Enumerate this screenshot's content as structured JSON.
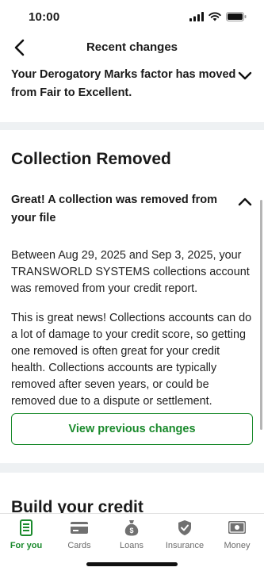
{
  "status_bar": {
    "time": "10:00"
  },
  "nav": {
    "title": "Recent changes"
  },
  "factor_card": {
    "text": "Your Derogatory Marks factor has moved from Fair to Excellent."
  },
  "collection_card": {
    "title": "Collection Removed",
    "accordion_title": "Great! A collection was removed from your file",
    "paragraph_1": "Between Aug 29, 2025 and Sep 3, 2025, your TRANSWORLD SYSTEMS collections account was removed from your credit report.",
    "paragraph_2": "This is great news! Collections accounts can do a lot of damage to your credit score, so getting one removed is often great for your credit health. Collections accounts are typically removed after seven years, or could be removed due to a dispute or settlement.",
    "button_label": "View previous changes"
  },
  "build_section": {
    "title": "Build your credit"
  },
  "tabs": [
    {
      "label": "For you",
      "icon": "document-icon",
      "active": true
    },
    {
      "label": "Cards",
      "icon": "credit-card-icon",
      "active": false
    },
    {
      "label": "Loans",
      "icon": "money-bag-icon",
      "active": false
    },
    {
      "label": "Insurance",
      "icon": "shield-check-icon",
      "active": false
    },
    {
      "label": "Money",
      "icon": "cash-icon",
      "active": false
    }
  ],
  "colors": {
    "accent": "#1a8a2c",
    "separator": "#eef1f3",
    "text": "#1a1a1a"
  }
}
